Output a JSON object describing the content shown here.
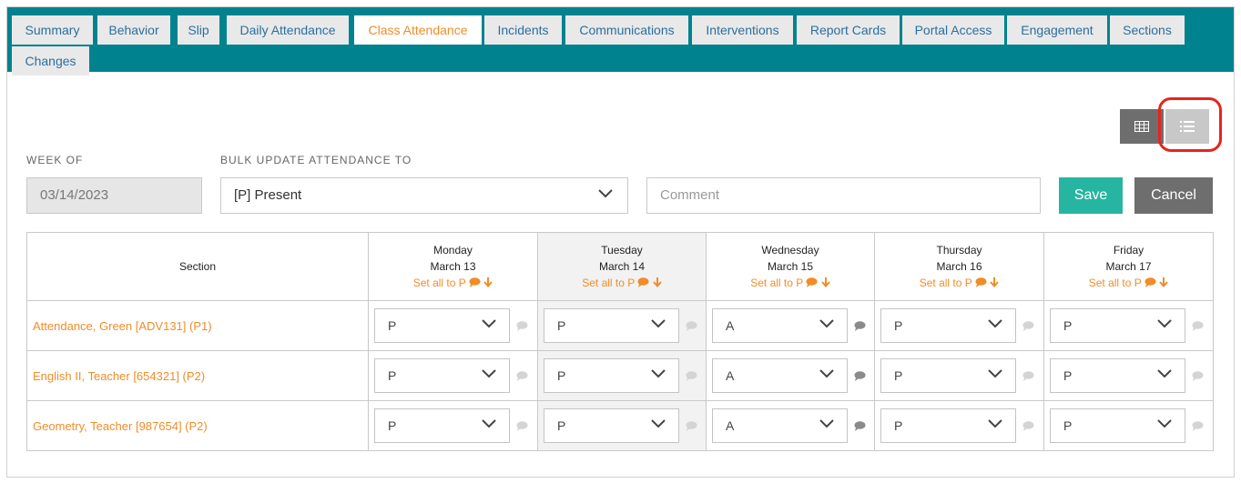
{
  "tabs": [
    {
      "label": "Summary",
      "active": false
    },
    {
      "label": "Behavior",
      "active": false
    },
    {
      "label": "Slip",
      "active": false
    },
    {
      "label": "Daily Attendance",
      "active": false
    },
    {
      "label": "Class Attendance",
      "active": true
    },
    {
      "label": "Incidents",
      "active": false
    },
    {
      "label": "Communications",
      "active": false
    },
    {
      "label": "Interventions",
      "active": false
    },
    {
      "label": "Report Cards",
      "active": false
    },
    {
      "label": "Portal Access",
      "active": false
    },
    {
      "label": "Engagement",
      "active": false
    },
    {
      "label": "Sections",
      "active": false
    },
    {
      "label": "Changes",
      "active": false
    }
  ],
  "filters": {
    "week_of_label": "WEEK OF",
    "week_of_value": "03/14/2023",
    "bulk_label": "BULK UPDATE ATTENDANCE TO",
    "bulk_value": "[P] Present",
    "comment_placeholder": "Comment",
    "save_label": "Save",
    "cancel_label": "Cancel"
  },
  "table": {
    "section_header": "Section",
    "set_all_label": "Set all to P",
    "days": [
      {
        "day": "Monday",
        "date": "March 13",
        "highlighted": false
      },
      {
        "day": "Tuesday",
        "date": "March 14",
        "highlighted": true
      },
      {
        "day": "Wednesday",
        "date": "March 15",
        "highlighted": false
      },
      {
        "day": "Thursday",
        "date": "March 16",
        "highlighted": false
      },
      {
        "day": "Friday",
        "date": "March 17",
        "highlighted": false
      }
    ],
    "rows": [
      {
        "section": "Attendance, Green [ADV131] (P1)",
        "values": [
          "P",
          "P",
          "A",
          "P",
          "P"
        ]
      },
      {
        "section": "English II, Teacher [654321] (P2)",
        "values": [
          "P",
          "P",
          "A",
          "P",
          "P"
        ]
      },
      {
        "section": "Geometry, Teacher [987654] (P2)",
        "values": [
          "P",
          "P",
          "A",
          "P",
          "P"
        ]
      }
    ]
  },
  "colors": {
    "accent": "#f28c28",
    "tabbar": "#00838f",
    "save": "#26b5a0",
    "cancel": "#6e6e6e",
    "highlight_ring": "#e8231e"
  },
  "icons": {
    "grid_view": "grid-view-icon",
    "list_view": "list-view-icon",
    "comment": "comment-icon",
    "arrow_down": "arrow-down-icon",
    "chevron": "chevron-down-icon"
  }
}
